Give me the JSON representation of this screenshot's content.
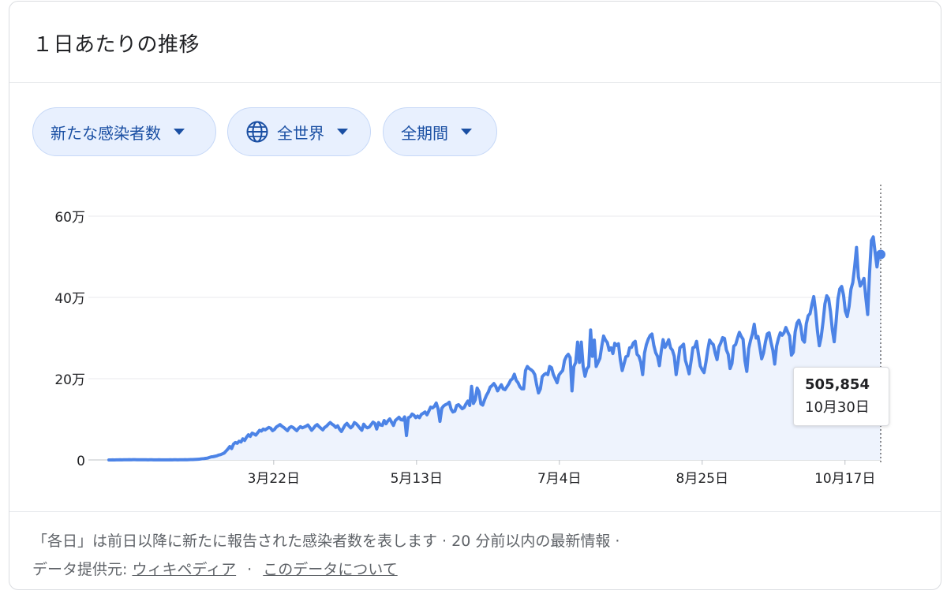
{
  "header": {
    "title": "１日あたりの推移"
  },
  "filters": [
    {
      "label": "新たな感染者数"
    },
    {
      "label": "全世界"
    },
    {
      "label": "全期間"
    }
  ],
  "chart_data": {
    "type": "area",
    "y_tick_labels": [
      "0",
      "20万",
      "40万",
      "60万"
    ],
    "y_ticks": [
      0,
      200000,
      400000,
      600000
    ],
    "ylim": [
      0,
      600000
    ],
    "x_tick_labels": [
      "3月22日",
      "5月13日",
      "7月4日",
      "8月25日",
      "10月17日"
    ],
    "x_tick_day_index": [
      60,
      112,
      164,
      216,
      268
    ],
    "day_index_range": [
      0,
      281
    ],
    "series": [
      {
        "values": [
          0,
          100,
          200,
          100,
          300,
          200,
          400,
          300,
          500,
          600,
          500,
          700,
          600,
          800,
          700,
          600,
          500,
          400,
          600,
          500,
          400,
          300,
          500,
          400,
          300,
          200,
          300,
          400,
          300,
          200,
          300,
          200,
          300,
          400,
          300,
          500,
          400,
          300,
          500,
          600,
          500,
          700,
          600,
          800,
          900,
          1000,
          1200,
          1500,
          1800,
          2200,
          2800,
          3200,
          3800,
          4500,
          6000,
          7500,
          8000,
          9000,
          10000,
          12000,
          13000,
          15000,
          17000,
          22000,
          27000,
          33000,
          28000,
          39000,
          43000,
          41000,
          46000,
          44000,
          52000,
          48000,
          56000,
          62000,
          58000,
          66000,
          64000,
          61000,
          67000,
          73000,
          71000,
          76000,
          74000,
          77000,
          80000,
          78000,
          72000,
          75000,
          81000,
          84000,
          87000,
          83000,
          80000,
          76000,
          72000,
          79000,
          82000,
          80000,
          76000,
          72000,
          78000,
          82000,
          79000,
          81000,
          83000,
          86000,
          80000,
          73000,
          78000,
          84000,
          87000,
          82000,
          78000,
          74000,
          80000,
          83000,
          88000,
          92000,
          88000,
          85000,
          80000,
          84000,
          76000,
          70000,
          78000,
          86000,
          90000,
          84000,
          79000,
          83000,
          92000,
          89000,
          84000,
          78000,
          73000,
          88000,
          82000,
          79000,
          81000,
          87000,
          93000,
          90000,
          76000,
          92000,
          86000,
          85000,
          97000,
          89000,
          96000,
          101000,
          93000,
          85000,
          97000,
          101000,
          105000,
          99000,
          98000,
          106000,
          60000,
          104000,
          106000,
          113000,
          110000,
          104000,
          108000,
          104000,
          112000,
          115000,
          118000,
          111000,
          120000,
          130000,
          128000,
          132000,
          140000,
          126000,
          95000,
          127000,
          133000,
          136000,
          138000,
          142000,
          125000,
          118000,
          120000,
          134000,
          136000,
          131000,
          126000,
          129000,
          138000,
          145000,
          134000,
          181000,
          139000,
          148000,
          177000,
          168000,
          138000,
          135000,
          148000,
          159000,
          167000,
          179000,
          183000,
          188000,
          181000,
          170000,
          178000,
          185000,
          175000,
          173000,
          180000,
          187000,
          196000,
          200000,
          211000,
          196000,
          190000,
          180000,
          175000,
          175000,
          220000,
          230000,
          225000,
          222000,
          218000,
          210000,
          185000,
          165000,
          175000,
          205000,
          210000,
          213000,
          210000,
          230000,
          227000,
          210000,
          200000,
          190000,
          209000,
          215000,
          220000,
          245000,
          255000,
          260000,
          252000,
          170000,
          230000,
          240000,
          290000,
          240000,
          290000,
          230000,
          206000,
          224000,
          230000,
          320000,
          255000,
          295000,
          230000,
          240000,
          250000,
          280000,
          305000,
          295000,
          289000,
          270000,
          276000,
          262000,
          287000,
          282000,
          286000,
          246000,
          220000,
          237000,
          254000,
          256000,
          276000,
          277000,
          288000,
          292000,
          260000,
          255000,
          240000,
          210000,
          263000,
          284000,
          297000,
          306000,
          310000,
          282000,
          264000,
          255000,
          232000,
          268000,
          296000,
          277000,
          285000,
          296000,
          276000,
          270000,
          255000,
          210000,
          240000,
          276000,
          280000,
          285000,
          245000,
          230000,
          212000,
          242000,
          276000,
          278000,
          292000,
          260000,
          231000,
          222000,
          215000,
          240000,
          271000,
          295000,
          288000,
          284000,
          263000,
          247000,
          278000,
          288000,
          301000,
          299000,
          271000,
          260000,
          225000,
          237000,
          280000,
          284000,
          300000,
          314000,
          304000,
          297000,
          244000,
          218000,
          274000,
          294000,
          310000,
          334000,
          300000,
          304000,
          277000,
          249000,
          263000,
          290000,
          310000,
          313000,
          290000,
          270000,
          236000,
          280000,
          299000,
          313000,
          307000,
          313000,
          326000,
          315000,
          305000,
          258000,
          265000,
          315000,
          337000,
          344000,
          329000,
          296000,
          290000,
          335000,
          355000,
          360000,
          383000,
          402000,
          366000,
          317000,
          281000,
          303000,
          340000,
          384000,
          404000,
          397000,
          365000,
          320000,
          291000,
          340000,
          396000,
          421000,
          427000,
          406000,
          366000,
          353000,
          378000,
          420000,
          437000,
          476000,
          523000,
          451000,
          428000,
          437000,
          447000,
          399000,
          358000,
          460000,
          540000,
          549000,
          510000,
          475000,
          506000,
          505854
        ]
      }
    ],
    "highlight": {
      "value": "505,854",
      "date": "10月30日"
    }
  },
  "footer": {
    "line1": "「各日」は前日以降に新たに報告された感染者数を表します · 20 分前以内の最新情報  ·",
    "source_prefix": "データ提供元:",
    "source_link": "ウィキペディア",
    "separator": "·",
    "about_link": "このデータについて"
  },
  "colors": {
    "line": "#4c83e6",
    "area": "#eef3fd",
    "chip_bg": "#e8f0fe",
    "chip_text": "#1a4fa3"
  },
  "icons": {
    "filter_globe": "globe-icon",
    "dropdown": "caret-down-icon"
  }
}
